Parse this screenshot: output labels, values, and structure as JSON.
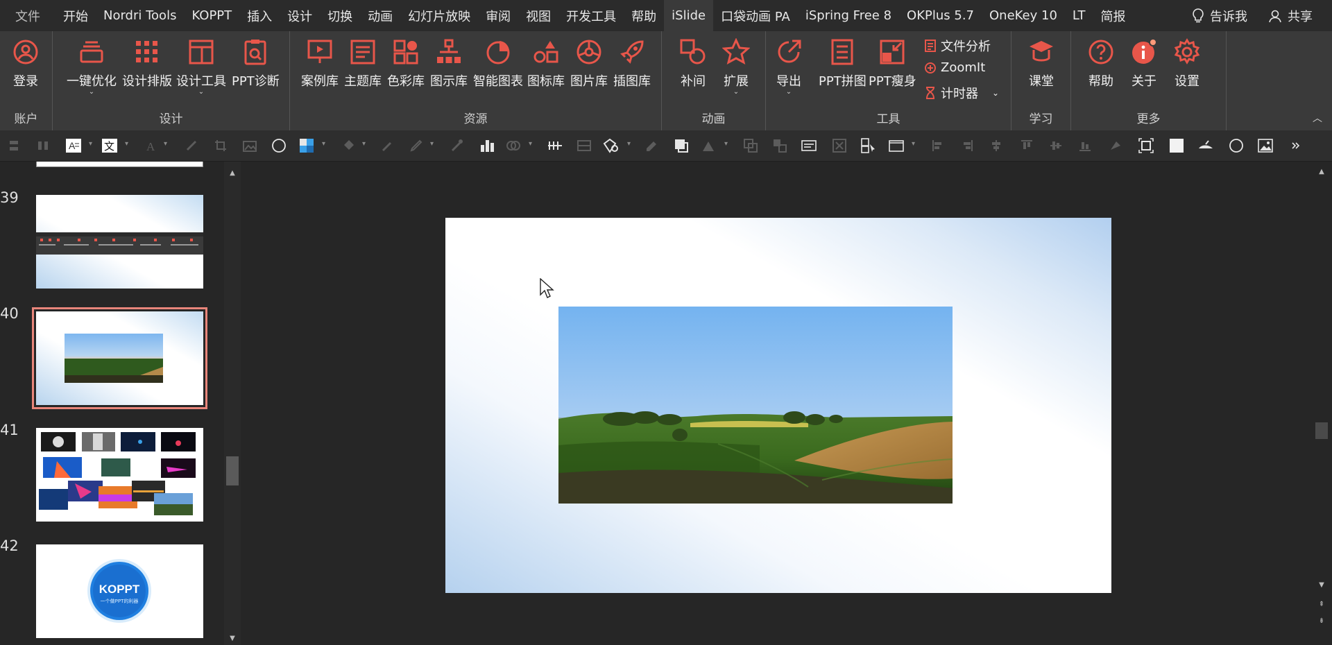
{
  "menubar": {
    "tabs": [
      "文件",
      "开始",
      "Nordri Tools",
      "KOPPT",
      "插入",
      "设计",
      "切换",
      "动画",
      "幻灯片放映",
      "审阅",
      "视图",
      "开发工具",
      "帮助",
      "iSlide",
      "口袋动画 PA",
      "iSpring Free 8",
      "OKPlus 5.7",
      "OneKey 10",
      "LT",
      "简报"
    ],
    "active_tab": "iSlide",
    "tell_me": "告诉我",
    "share": "共享"
  },
  "ribbon": {
    "groups": {
      "account": "账户",
      "design": "设计",
      "resources": "资源",
      "animation": "动画",
      "tools": "工具",
      "learn": "学习",
      "more": "更多"
    },
    "buttons": {
      "login": "登录",
      "one_click_optimize": "一键优化",
      "design_layout": "设计排版",
      "design_tools": "设计工具",
      "ppt_diagnose": "PPT诊断",
      "case_library": "案例库",
      "theme_library": "主题库",
      "color_library": "色彩库",
      "diagram_library": "图示库",
      "smart_chart": "智能图表",
      "icon_library": "图标库",
      "picture_library": "图片库",
      "illustration_library": "插图库",
      "tween": "补间",
      "extend": "扩展",
      "export": "导出",
      "ppt_collage": "PPT拼图",
      "ppt_slim": "PPT瘦身",
      "file_analysis": "文件分析",
      "zoomit": "ZoomIt",
      "timer": "计时器",
      "classroom": "课堂",
      "help": "帮助",
      "about": "关于",
      "settings": "设置"
    }
  },
  "thumbnails": [
    {
      "number": "39"
    },
    {
      "number": "40",
      "selected": true
    },
    {
      "number": "41"
    },
    {
      "number": "42",
      "logo_text": "KOPPT",
      "logo_subtext": "一个做PPT的利器"
    }
  ],
  "colors": {
    "accent_red": "#e8564a",
    "selection": "#e8857a",
    "ribbon_bg": "#3a3a3a",
    "menubar_bg": "#2b2b2b"
  }
}
